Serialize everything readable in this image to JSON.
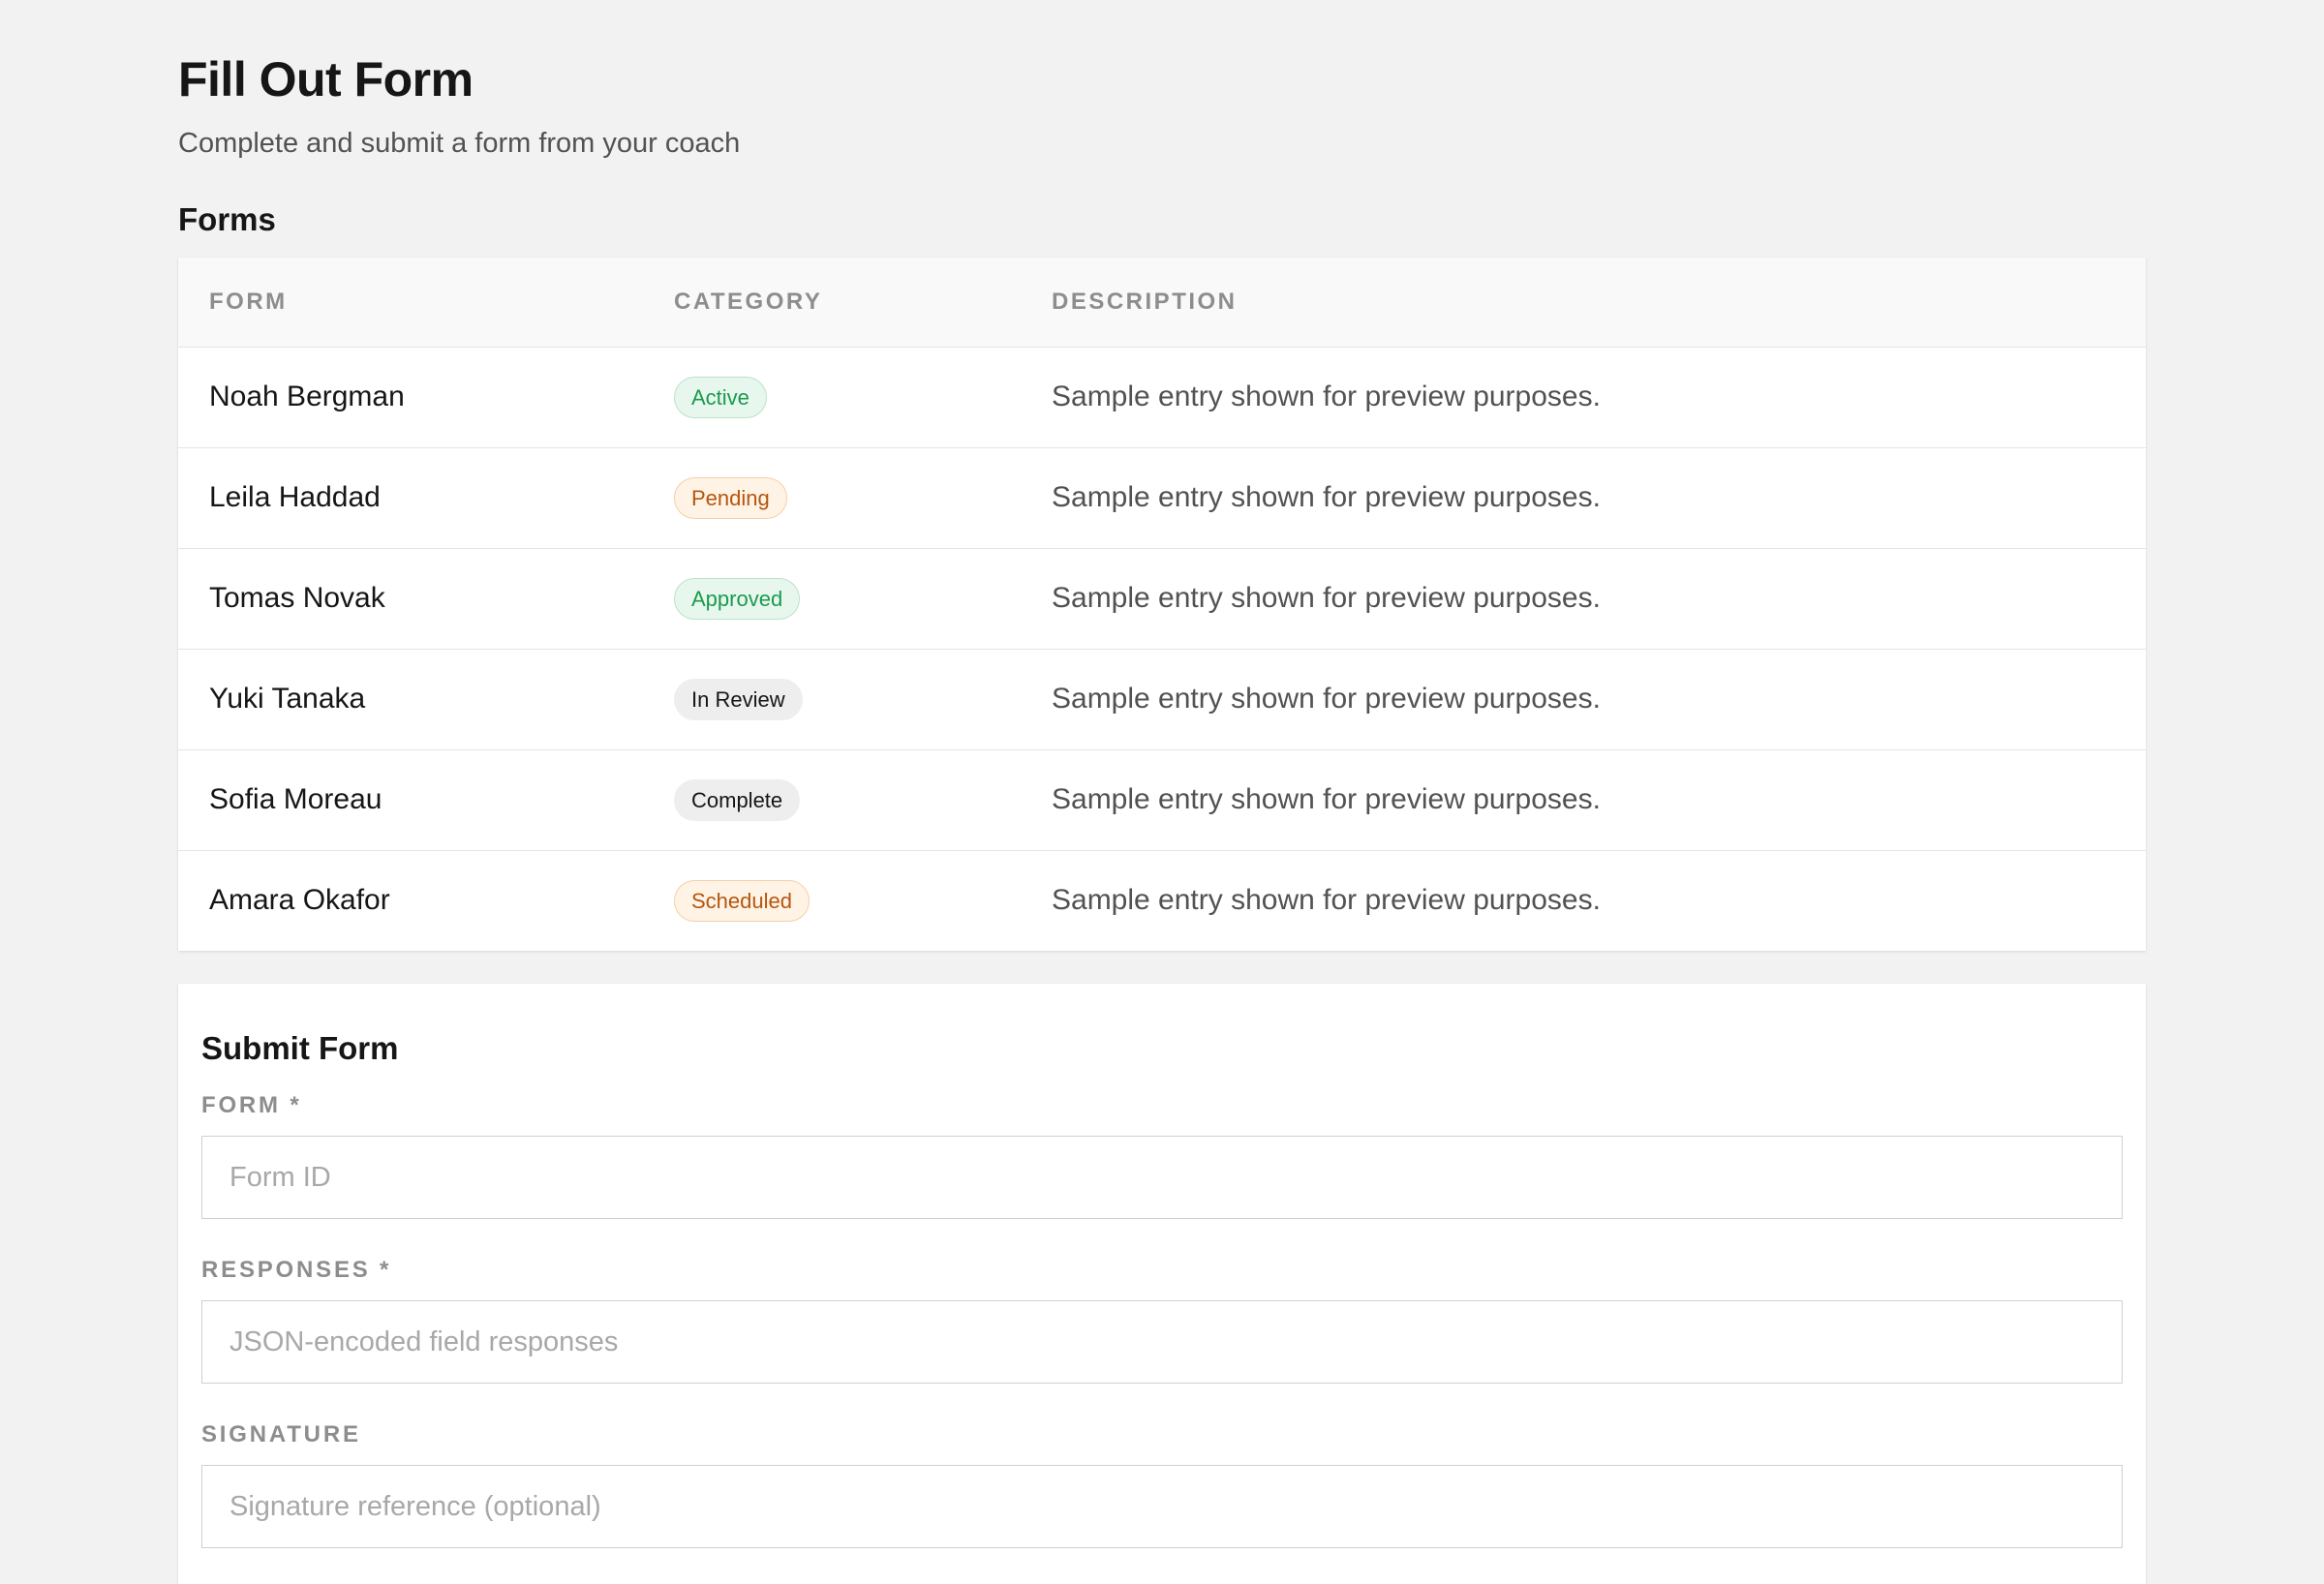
{
  "header": {
    "title": "Fill Out Form",
    "subtitle": "Complete and submit a form from your coach"
  },
  "forms_section": {
    "title": "Forms",
    "columns": [
      "FORM",
      "CATEGORY",
      "DESCRIPTION"
    ],
    "rows": [
      {
        "name": "Noah Bergman",
        "category": "Active",
        "tone": "green",
        "description": "Sample entry shown for preview purposes."
      },
      {
        "name": "Leila Haddad",
        "category": "Pending",
        "tone": "orange",
        "description": "Sample entry shown for preview purposes."
      },
      {
        "name": "Tomas Novak",
        "category": "Approved",
        "tone": "green",
        "description": "Sample entry shown for preview purposes."
      },
      {
        "name": "Yuki Tanaka",
        "category": "In Review",
        "tone": "gray",
        "description": "Sample entry shown for preview purposes."
      },
      {
        "name": "Sofia Moreau",
        "category": "Complete",
        "tone": "gray",
        "description": "Sample entry shown for preview purposes."
      },
      {
        "name": "Amara Okafor",
        "category": "Scheduled",
        "tone": "orange",
        "description": "Sample entry shown for preview purposes."
      }
    ]
  },
  "submit_form": {
    "title": "Submit Form",
    "fields": {
      "form": {
        "label": "FORM *",
        "placeholder": "Form ID",
        "value": ""
      },
      "responses": {
        "label": "RESPONSES *",
        "placeholder": "JSON-encoded field responses",
        "value": ""
      },
      "signature": {
        "label": "SIGNATURE",
        "placeholder": "Signature reference (optional)",
        "value": ""
      }
    }
  },
  "colors": {
    "background": "#f2f2f2",
    "badge_green": "#1a9a4c",
    "badge_orange": "#b5560c",
    "badge_gray": "#161616"
  }
}
